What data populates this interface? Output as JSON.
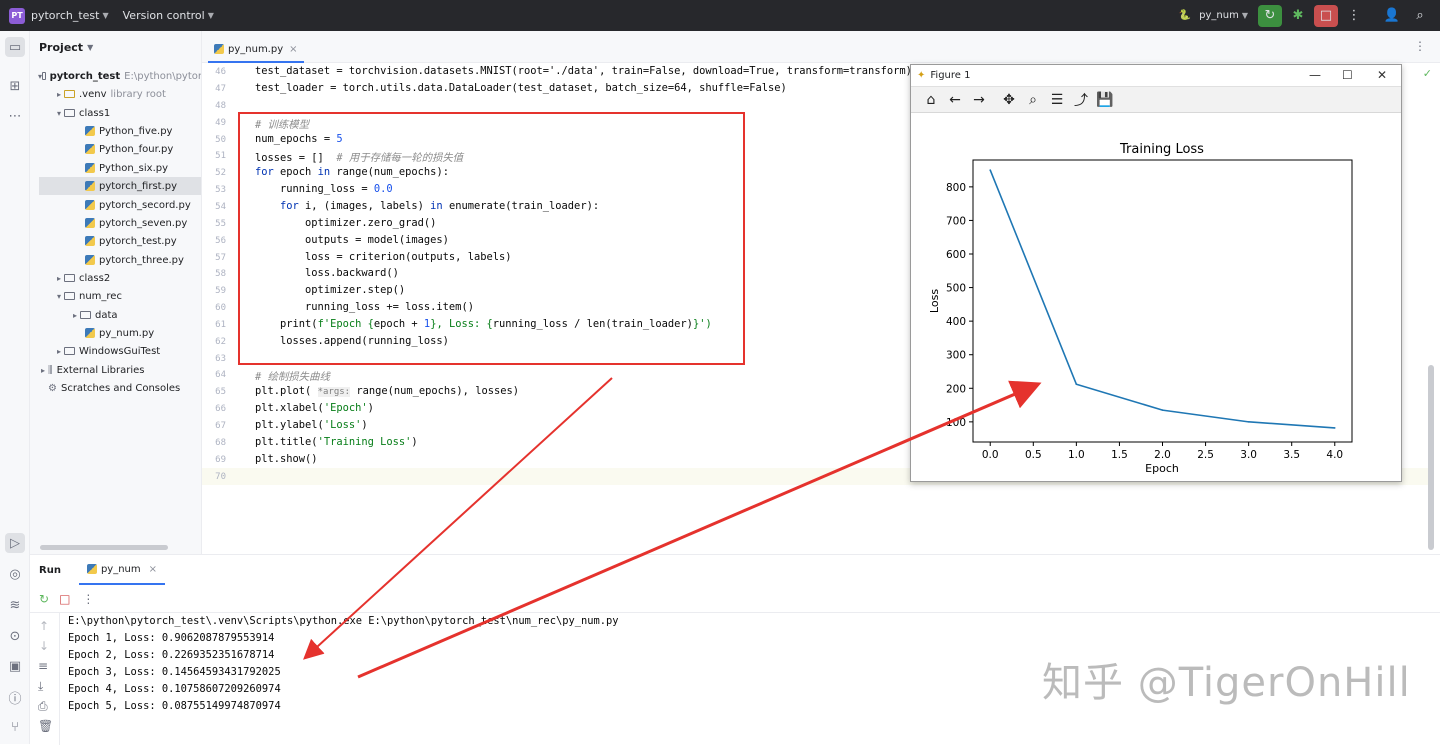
{
  "titlebar": {
    "project_badge": "PT",
    "project_name": "pytorch_test",
    "vcs_label": "Version control",
    "run_config": "py_num"
  },
  "project_panel": {
    "title": "Project",
    "items": [
      {
        "label": "pytorch_test",
        "note": "E:\\python\\pytor"
      },
      {
        "label": ".venv",
        "note": "library root"
      },
      {
        "label": "class1"
      },
      {
        "label": "Python_five.py"
      },
      {
        "label": "Python_four.py"
      },
      {
        "label": "Python_six.py"
      },
      {
        "label": "pytorch_first.py"
      },
      {
        "label": "pytorch_secord.py"
      },
      {
        "label": "pytorch_seven.py"
      },
      {
        "label": "pytorch_test.py"
      },
      {
        "label": "pytorch_three.py"
      },
      {
        "label": "class2"
      },
      {
        "label": "num_rec"
      },
      {
        "label": "data"
      },
      {
        "label": "py_num.py"
      },
      {
        "label": "WindowsGuiTest"
      },
      {
        "label": "External Libraries"
      },
      {
        "label": "Scratches and Consoles"
      }
    ]
  },
  "editor": {
    "tab_label": "py_num.py",
    "line_numbers": [
      "46",
      "47",
      "48",
      "49",
      "50",
      "51",
      "52",
      "53",
      "54",
      "55",
      "56",
      "57",
      "58",
      "59",
      "60",
      "61",
      "62",
      "63",
      "64",
      "65",
      "66",
      "67",
      "68",
      "69",
      "70"
    ],
    "code": {
      "l46": "test_dataset = torchvision.datasets.MNIST(root='./data', train=False, download=True, transform=transform)",
      "l47": "test_loader = torch.utils.data.DataLoader(test_dataset, batch_size=64, shuffle=False)",
      "l49": "# 训练模型",
      "l50a": "num_epochs = ",
      "l50b": "5",
      "l51a": "losses = []  ",
      "l51b": "# 用于存储每一轮的损失值",
      "l52a": "for",
      "l52b": " epoch ",
      "l52c": "in",
      "l52d": " range(num_epochs):",
      "l53a": "    running_loss = ",
      "l53b": "0.0",
      "l54a": "    for",
      "l54b": " i, (images, labels) ",
      "l54c": "in",
      "l54d": " enumerate(train_loader):",
      "l55": "        optimizer.zero_grad()",
      "l56": "        outputs = model(images)",
      "l57": "        loss = criterion(outputs, labels)",
      "l58": "        loss.backward()",
      "l59": "        optimizer.step()",
      "l60": "        running_loss += loss.item()",
      "l61a": "    print(",
      "l61b": "f'Epoch {",
      "l61c": "epoch + ",
      "l61d": "1",
      "l61e": "}, Loss: {",
      "l61f": "running_loss / len(train_loader)",
      "l61g": "}')",
      "l62": "    losses.append(running_loss)",
      "l64": "# 绘制损失曲线",
      "l65a": "plt.plot( ",
      "l65hint": "*args:",
      "l65b": " range(num_epochs), losses)",
      "l66a": "plt.xlabel(",
      "l66b": "'Epoch'",
      "l66c": ")",
      "l67a": "plt.ylabel(",
      "l67b": "'Loss'",
      "l67c": ")",
      "l68a": "plt.title(",
      "l68b": "'Training Loss'",
      "l68c": ")",
      "l69": "plt.show()"
    }
  },
  "figure_window": {
    "title": "Figure 1",
    "minimize": "—",
    "maximize": "☐",
    "close": "✕",
    "tools": [
      "home-icon",
      "back-icon",
      "forward-icon",
      "pan-icon",
      "zoom-icon",
      "configure-icon",
      "edit-axis-icon",
      "save-icon"
    ]
  },
  "chart_data": {
    "type": "line",
    "title": "Training Loss",
    "xlabel": "Epoch",
    "ylabel": "Loss",
    "x": [
      0,
      1,
      2,
      3,
      4
    ],
    "series": [
      {
        "values": [
          850,
          212,
          135,
          100,
          82
        ],
        "color": "#1f77b4"
      }
    ],
    "xlim": [
      -0.2,
      4.2
    ],
    "ylim": [
      40,
      880
    ],
    "xticks": [
      "0.0",
      "0.5",
      "1.0",
      "1.5",
      "2.0",
      "2.5",
      "3.0",
      "3.5",
      "4.0"
    ],
    "xtick_values": [
      0,
      0.5,
      1,
      1.5,
      2,
      2.5,
      3,
      3.5,
      4
    ],
    "yticks": [
      "100",
      "200",
      "300",
      "400",
      "500",
      "600",
      "700",
      "800"
    ],
    "ytick_values": [
      100,
      200,
      300,
      400,
      500,
      600,
      700,
      800
    ],
    "grid": false
  },
  "run_panel": {
    "run_label": "Run",
    "tab_label": "py_num",
    "command": "E:\\python\\pytorch_test\\.venv\\Scripts\\python.exe E:\\python\\pytorch_test\\num_rec\\py_num.py",
    "output": [
      "Epoch 1, Loss: 0.9062087879553914",
      "Epoch 2, Loss: 0.2269352351678714",
      "Epoch 3, Loss: 0.14564593431792025",
      "Epoch 4, Loss: 0.10758607209260974",
      "Epoch 5, Loss: 0.08755149974870974"
    ]
  },
  "watermark": "知乎 @TigerOnHill",
  "colors": {
    "annotation_red": "#e5322d",
    "line_blue": "#1f77b4"
  }
}
